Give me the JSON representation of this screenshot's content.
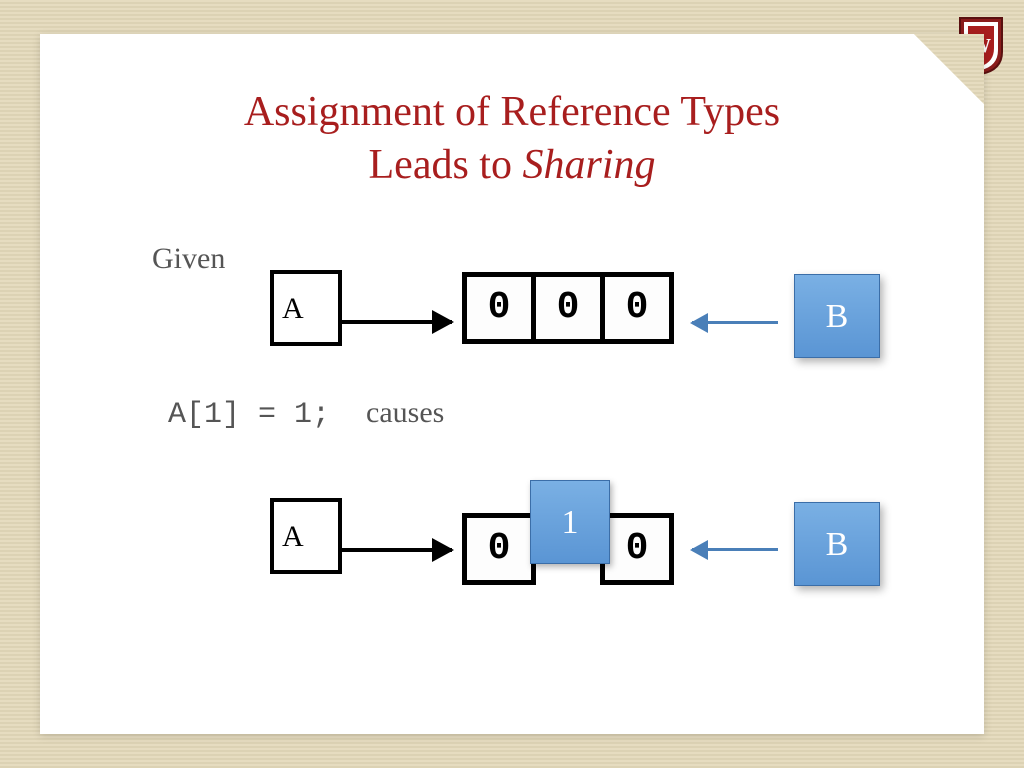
{
  "title_line1": "Assignment of Reference Types",
  "title_line2a": "Leads to ",
  "title_line2b": "Sharing",
  "given_label": "Given",
  "causes_code": "A[1] = 1;",
  "causes_word": "causes",
  "label_A": "A",
  "label_B": "B",
  "row1_cells": [
    "0",
    "0",
    "0"
  ],
  "row2_cells": [
    "0",
    "",
    "0"
  ],
  "overlay_value": "1",
  "crest_letter": "W"
}
